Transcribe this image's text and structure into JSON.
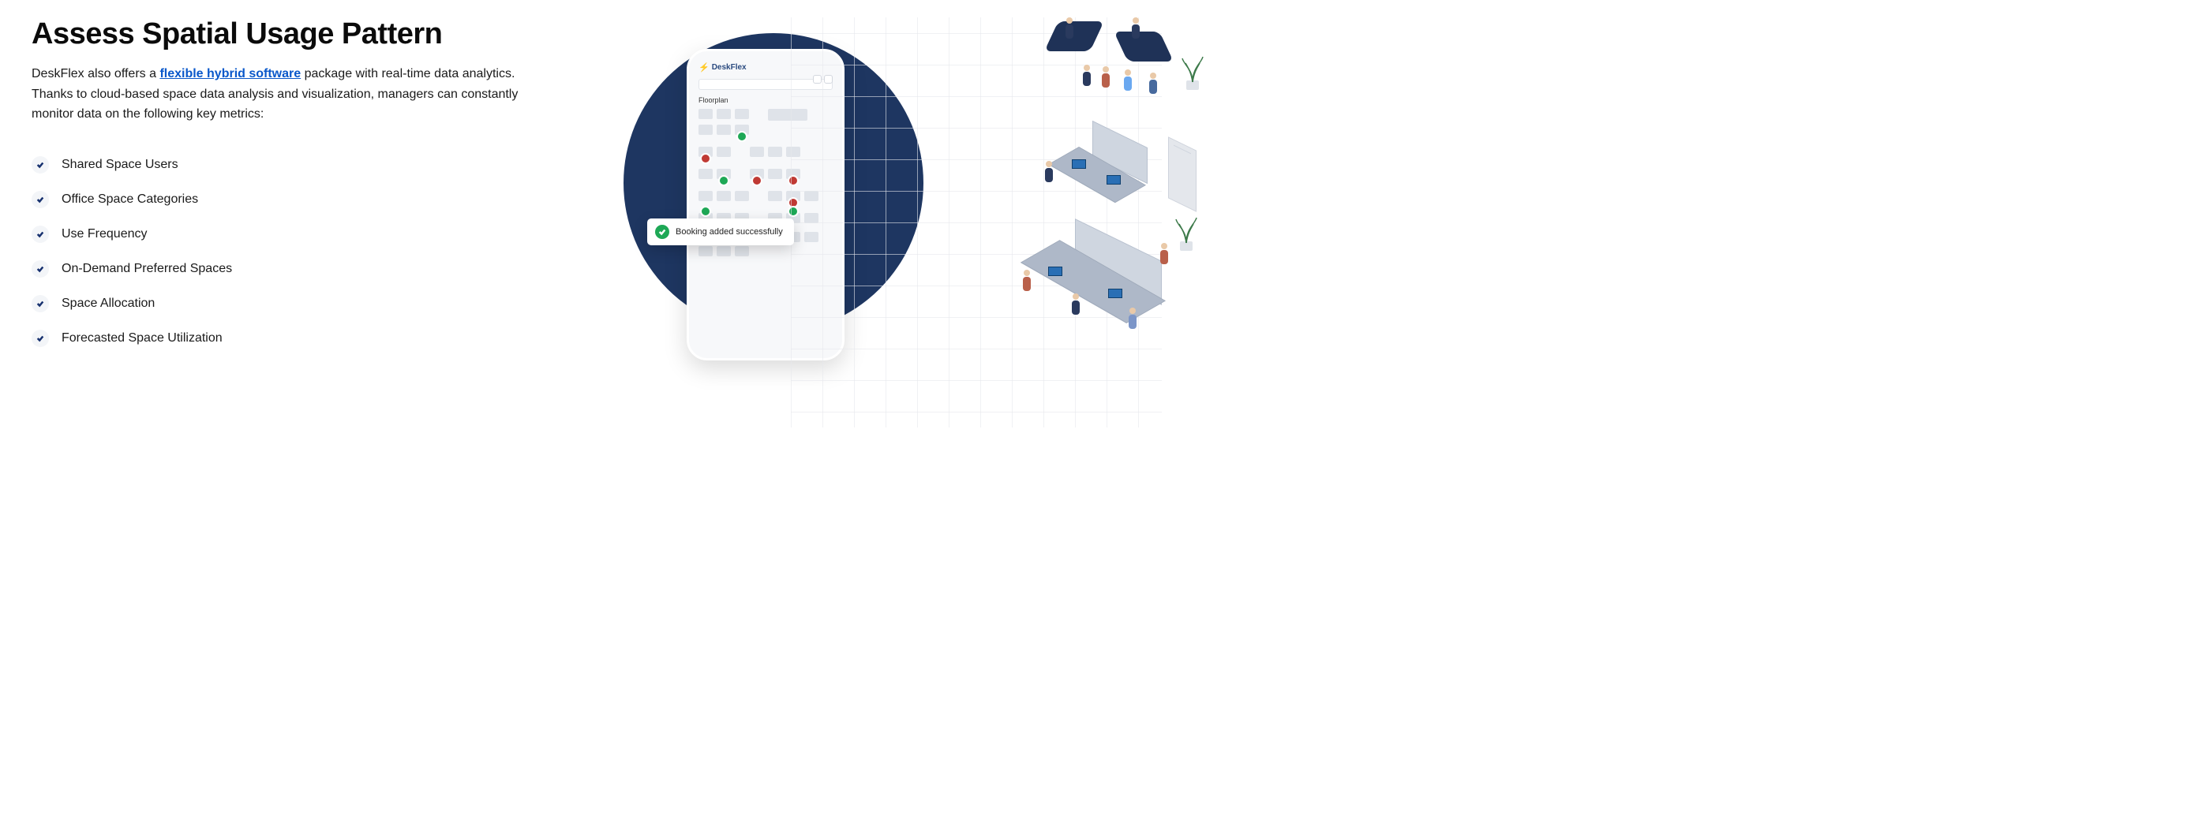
{
  "heading": "Assess Spatial Usage Pattern",
  "lead_pre": "DeskFlex also offers a ",
  "lead_link": "flexible hybrid software",
  "lead_post": " package with real-time data analytics. Thanks to cloud-based space data analysis and visualization, managers can constantly monitor data on the following key metrics:",
  "metrics": [
    "Shared Space Users",
    "Office Space Categories",
    "Use Frequency",
    "On-Demand Preferred Spaces",
    "Space Allocation",
    "Forecasted Space Utilization"
  ],
  "phone": {
    "brand": "DeskFlex",
    "section": "Floorplan"
  },
  "toast": "Booking added successfully"
}
